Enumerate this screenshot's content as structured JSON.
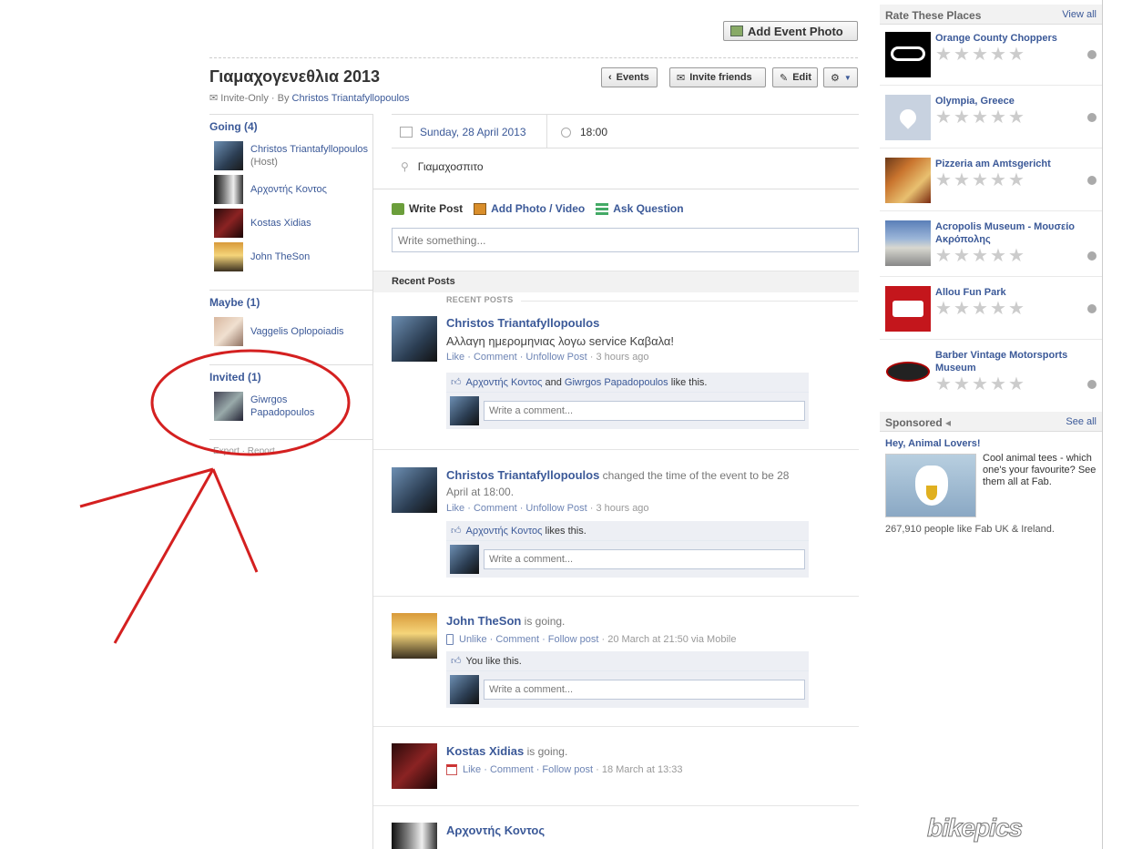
{
  "header": {
    "add_photo": "Add Event Photo",
    "title": "Γιαμαχογενεθλια 2013",
    "privacy": "Invite-Only",
    "by_prefix": " · By ",
    "host": "Christos Triantafyllopoulos",
    "events_btn": "Events",
    "invite_btn": "Invite friends",
    "edit_btn": "Edit"
  },
  "details": {
    "date": "Sunday, 28 April 2013",
    "time": "18:00",
    "location": "Γιαμαχοσπιτο"
  },
  "sidebar": {
    "going_label": "Going (4)",
    "going": [
      {
        "name": "Christos Triantafyllopoulos",
        "sub": "(Host)"
      },
      {
        "name": "Αρχοντής Κοντος",
        "sub": ""
      },
      {
        "name": "Kostas Xidias",
        "sub": ""
      },
      {
        "name": "John TheSon",
        "sub": ""
      }
    ],
    "maybe_label": "Maybe (1)",
    "maybe": [
      {
        "name": "Vaggelis Oplopoiadis"
      }
    ],
    "invited_label": "Invited (1)",
    "invited": [
      {
        "name": "Giwrgos Papadopoulos"
      }
    ],
    "footer": "Export · Report"
  },
  "composer": {
    "write_post": "Write Post",
    "add_photo": "Add Photo / Video",
    "ask_question": "Ask Question",
    "placeholder": "Write something..."
  },
  "feed": {
    "bar": "Recent Posts",
    "label": "RECENT POSTS",
    "comment_placeholder": "Write a comment...",
    "posts": [
      {
        "name": "Christos Triantafyllopoulos",
        "action": "",
        "text": "Αλλαγη ημερομηνιας λογω service Καβαλα!",
        "actions": "Like · Comment · Unfollow Post",
        "time": " · 3 hours ago",
        "likes_a": "Αρχοντής Κοντος",
        "likes_mid": " and ",
        "likes_b": "Giwrgos Papadopoulos",
        "likes_end": " like this."
      },
      {
        "name": "Christos Triantafyllopoulos",
        "action": " changed the time of the event to be 28 April at 18:00.",
        "actions": "Like · Comment · Unfollow Post",
        "time": " · 3 hours ago",
        "likes_a": "Αρχοντής Κοντος",
        "likes_end": " likes this."
      },
      {
        "name": "John TheSon",
        "action": " is going.",
        "actions": "Unlike · Comment · Follow post",
        "time": " · 20 March at 21:50 via Mobile",
        "likes_end": "You like this."
      },
      {
        "name": "Kostas Xidias",
        "action": " is going.",
        "actions": "Like · Comment · Follow post",
        "time": " · 18 March at 13:33"
      },
      {
        "name": "Αρχοντής Κοντος",
        "action": ""
      }
    ]
  },
  "right": {
    "rate_title": "Rate These Places",
    "view_all": "View all",
    "places": [
      {
        "name": "Orange County Choppers"
      },
      {
        "name": "Olympia, Greece"
      },
      {
        "name": "Pizzeria am Amtsgericht"
      },
      {
        "name": "Acropolis Museum - Μουσείο Ακρόπολης"
      },
      {
        "name": "Allou Fun Park"
      },
      {
        "name": "Barber Vintage Motorsports Museum"
      }
    ],
    "sponsored_title": "Sponsored",
    "see_all": "See all",
    "ad": {
      "title": "Hey, Animal Lovers!",
      "text": "Cool animal tees - which one's your favourite? See them all at Fab.",
      "likes": "267,910 people like Fab UK & Ireland."
    }
  },
  "watermark": "bikepics"
}
